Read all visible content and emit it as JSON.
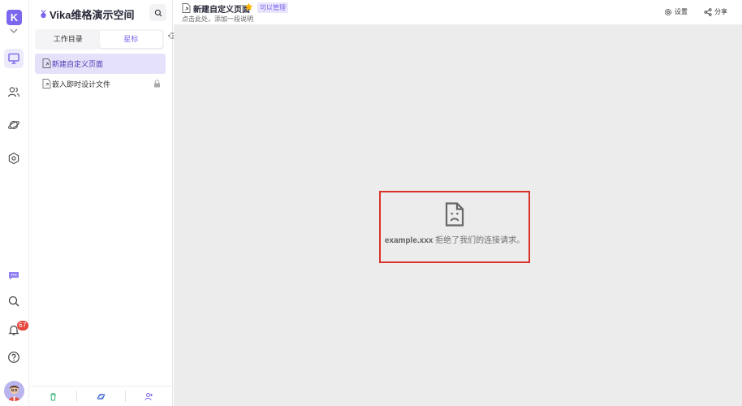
{
  "colors": {
    "accent": "#7b67ee",
    "error_border": "#d9322a",
    "badge": "#e8433a",
    "content_bg": "#ececec"
  },
  "rail": {
    "logo_letter": "K",
    "items": [
      {
        "name": "workbench",
        "icon": "monitor-icon",
        "active": true
      },
      {
        "name": "contacts",
        "icon": "people-icon",
        "active": false
      },
      {
        "name": "explore",
        "icon": "planet-icon",
        "active": false
      },
      {
        "name": "admin",
        "icon": "hexagon-gear-icon",
        "active": false
      }
    ],
    "notification_count": "67"
  },
  "sidebar": {
    "space_name": "Vika维格演示空间",
    "tabs": [
      {
        "label": "工作目录",
        "active": false
      },
      {
        "label": "星标",
        "active": true
      }
    ],
    "nodes": [
      {
        "label": "新建自定义页面",
        "active": true,
        "locked": false
      },
      {
        "label": "嵌入即时设计文件",
        "active": false,
        "locked": true
      }
    ]
  },
  "header": {
    "title": "新建自定义页面",
    "permission": "可以管理",
    "description": "点击此处，添加一段说明",
    "settings_label": "设置",
    "share_label": "分享"
  },
  "content": {
    "error_host": "example.xxx",
    "error_text": " 拒绝了我们的连接请求。"
  }
}
